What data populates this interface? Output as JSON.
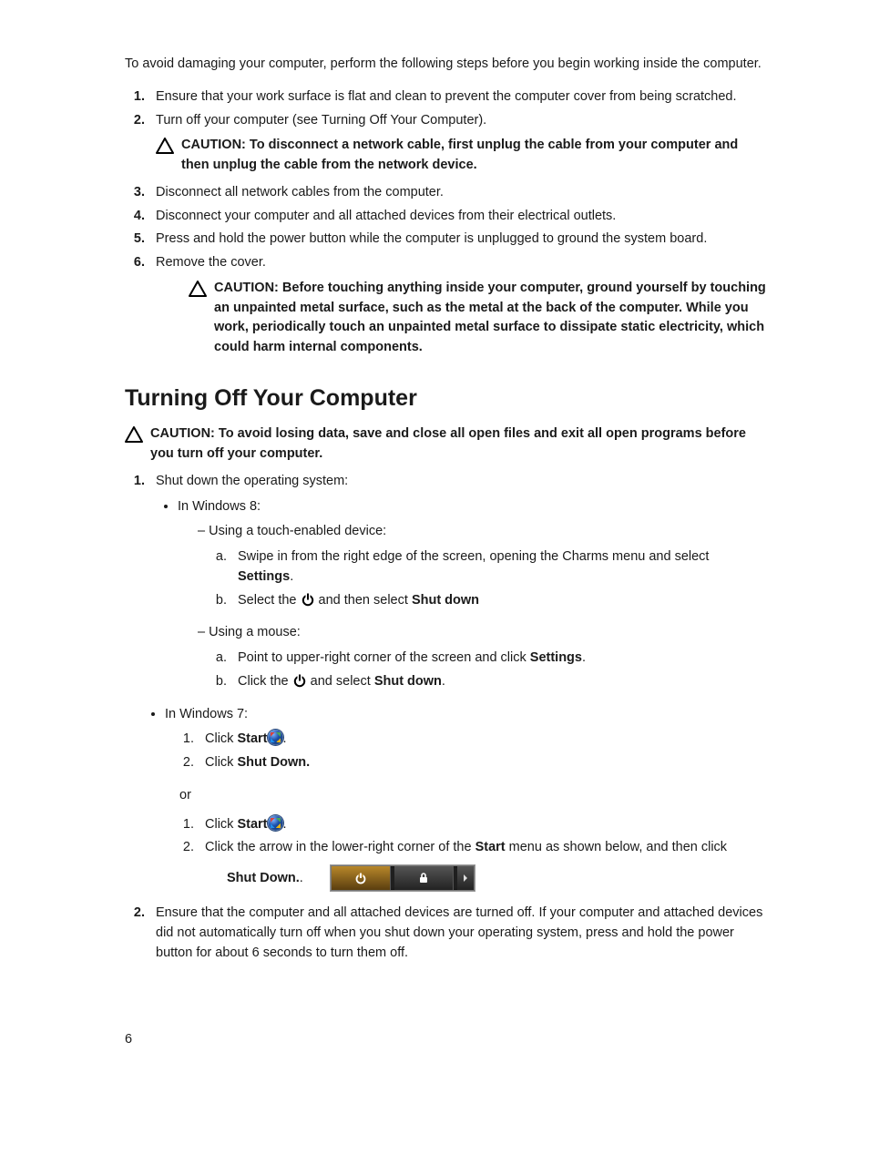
{
  "intro": "To avoid damaging your computer, perform the following steps before you begin working inside the computer.",
  "steps1": {
    "s1": "Ensure that your work surface is flat and clean to prevent the computer cover from being scratched.",
    "s2": "Turn off your computer (see Turning Off Your Computer).",
    "caution_net": "CAUTION: To disconnect a network cable, first unplug the cable from your computer and then unplug the cable from the network device.",
    "s3": "Disconnect all network cables from the computer.",
    "s4": "Disconnect your computer and all attached devices from their electrical outlets.",
    "s5": "Press and hold the power button while the computer is unplugged to ground the system board.",
    "s6": "Remove the cover.",
    "caution_ground": "CAUTION: Before touching anything inside your computer, ground yourself by touching an unpainted metal surface, such as the metal at the back of the computer. While you work, periodically touch an unpainted metal surface to dissipate static electricity, which could harm internal components."
  },
  "heading": "Turning Off Your Computer",
  "caution_data": "CAUTION: To avoid losing data, save and close all open files and exit all open programs before you turn off your computer.",
  "shutdown": {
    "intro": "Shut down the operating system:",
    "win8": "In Windows 8:",
    "touch_label": "Using a touch-enabled device:",
    "touch_a_pre": "Swipe in from the right edge of the screen, opening the Charms menu and select ",
    "touch_a_bold": "Settings",
    "touch_b_pre": "Select the ",
    "touch_b_mid": " and then select ",
    "shut_down_bold": "Shut down",
    "mouse_label": "Using a mouse:",
    "mouse_a_pre": "Point to upper-right corner of the screen and click ",
    "mouse_a_bold": "Settings",
    "mouse_b_pre": "Click the ",
    "mouse_b_mid": " and select ",
    "win7": "In Windows 7:",
    "w7_1_pre": "Click ",
    "w7_1_bold": "Start",
    "w7_2_pre": "Click ",
    "w7_2_bold": "Shut Down.",
    "or": "or",
    "w7b_2_pre": "Click the arrow in the lower-right corner of the ",
    "w7b_2_bold": "Start",
    "w7b_2_post": " menu as shown below, and then click",
    "w7b_shut": "Shut Down.",
    "period": ".",
    "double_period": ".."
  },
  "step2": "Ensure that the computer and all attached devices are turned off. If your computer and attached devices did not automatically turn off when you shut down your operating system, press and hold the power button for about 6 seconds to turn them off.",
  "page_number": "6"
}
